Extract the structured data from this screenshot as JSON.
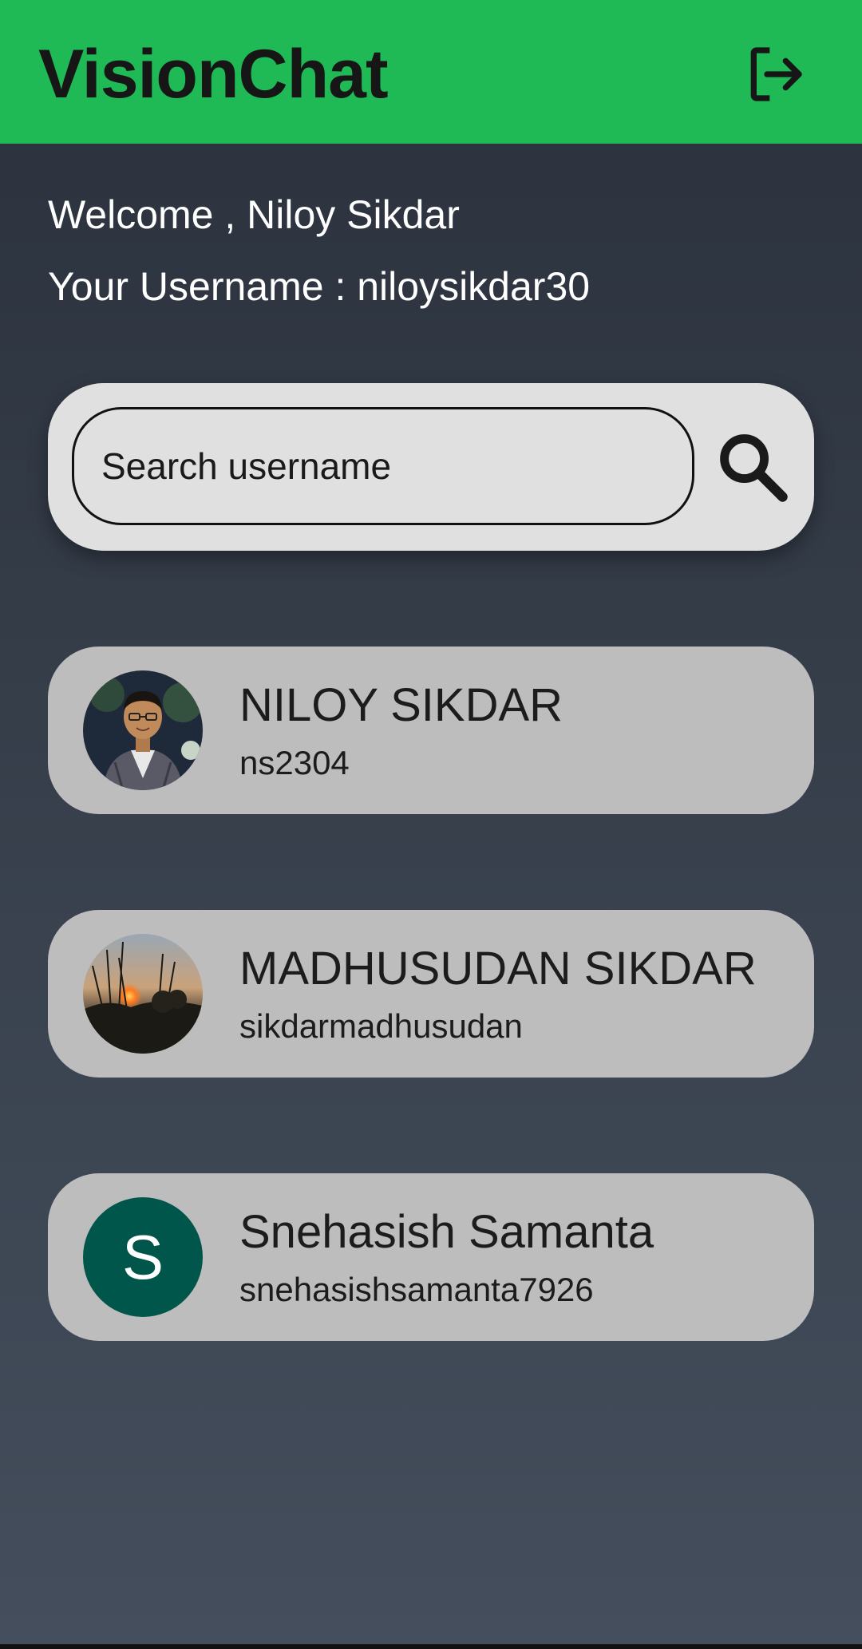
{
  "app_bar": {
    "title": "VisionChat",
    "logout_icon": "logout-icon",
    "color": "#1fba56"
  },
  "greeting": {
    "welcome": "Welcome , Niloy Sikdar",
    "username_line": "Your Username : niloysikdar30"
  },
  "search": {
    "placeholder": "Search username",
    "value": "",
    "icon": "search-icon"
  },
  "users": [
    {
      "name": "NILOY SIKDAR",
      "username": "ns2304",
      "avatar": "photo"
    },
    {
      "name": "MADHUSUDAN SIKDAR",
      "username": "sikdarmadhusudan",
      "avatar": "photo"
    },
    {
      "name": "Snehasish Samanta",
      "username": "snehasishsamanta7926",
      "avatar_letter": "S",
      "avatar_color": "#00564a"
    }
  ]
}
